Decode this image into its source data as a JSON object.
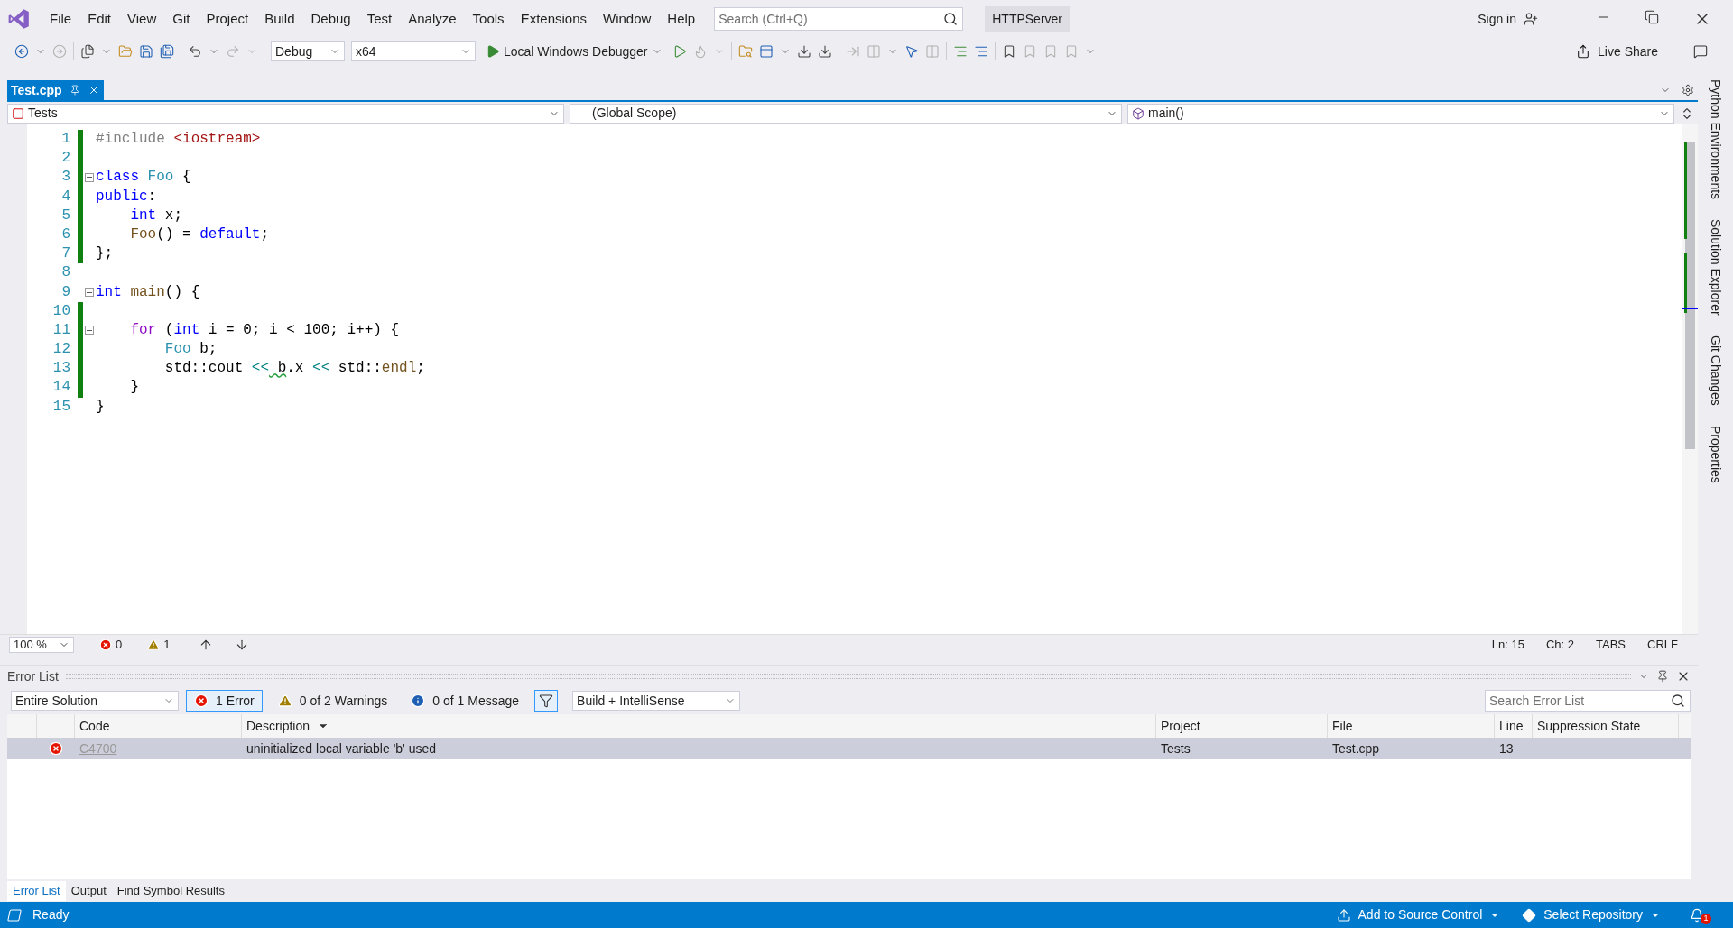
{
  "menu": [
    "File",
    "Edit",
    "View",
    "Git",
    "Project",
    "Build",
    "Debug",
    "Test",
    "Analyze",
    "Tools",
    "Extensions",
    "Window",
    "Help"
  ],
  "search": {
    "placeholder": "Search (Ctrl+Q)"
  },
  "solution_name": "HTTPServer",
  "sign_in": "Sign in",
  "toolbar": {
    "configuration": "Debug",
    "platform": "x64",
    "debugger": "Local Windows Debugger"
  },
  "live_share": "Live Share",
  "document_tabs": [
    {
      "label": "Test.cpp",
      "selected": true
    }
  ],
  "nav_bar": {
    "project": "Tests",
    "scope": "(Global Scope)",
    "member": "main()"
  },
  "editor": {
    "lines": [
      {
        "number": "1",
        "changed": true,
        "fold": false,
        "tokens": [
          {
            "kind": "pp",
            "text": "#include "
          },
          {
            "kind": "str",
            "text": "<iostream>"
          }
        ]
      },
      {
        "number": "2",
        "changed": true,
        "fold": false
      },
      {
        "number": "3",
        "changed": true,
        "fold": true,
        "tokens": [
          {
            "kind": "kw",
            "text": "class "
          },
          {
            "kind": "type",
            "text": "Foo"
          },
          {
            "kind": "plain",
            "text": " {"
          }
        ]
      },
      {
        "number": "4",
        "changed": true,
        "fold": false,
        "tokens": [
          {
            "kind": "kw",
            "text": "public"
          },
          {
            "kind": "plain",
            "text": ":"
          }
        ]
      },
      {
        "number": "5",
        "changed": true,
        "fold": false,
        "tokens": [
          {
            "kind": "kw",
            "text": "    int"
          },
          {
            "kind": "plain",
            "text": " x;"
          }
        ]
      },
      {
        "number": "6",
        "changed": true,
        "fold": false,
        "tokens": [
          {
            "kind": "fn",
            "text": "    Foo"
          },
          {
            "kind": "plain",
            "text": "() = "
          },
          {
            "kind": "kw",
            "text": "default"
          },
          {
            "kind": "plain",
            "text": ";"
          }
        ]
      },
      {
        "number": "7",
        "changed": true,
        "fold": false,
        "tokens": [
          {
            "kind": "plain",
            "text": "};"
          }
        ]
      },
      {
        "number": "8",
        "changed": false,
        "fold": false
      },
      {
        "number": "9",
        "changed": false,
        "fold": true,
        "tokens": [
          {
            "kind": "kw",
            "text": "int"
          },
          {
            "kind": "fn",
            "text": " main"
          },
          {
            "kind": "plain",
            "text": "() {"
          }
        ]
      },
      {
        "number": "10",
        "changed": true,
        "fold": false
      },
      {
        "number": "11",
        "changed": true,
        "fold": true,
        "tokens": [
          {
            "kind": "ctl",
            "text": "    for"
          },
          {
            "kind": "plain",
            "text": " ("
          },
          {
            "kind": "kw",
            "text": "int"
          },
          {
            "kind": "plain",
            "text": " i = 0; i < 100; i++) {"
          }
        ]
      },
      {
        "number": "12",
        "changed": true,
        "fold": false,
        "tokens": [
          {
            "kind": "type",
            "text": "        Foo"
          },
          {
            "kind": "plain",
            "text": " b;"
          }
        ]
      },
      {
        "number": "13",
        "changed": true,
        "fold": false,
        "tokens": [
          {
            "kind": "plain",
            "text": "        std::cout "
          },
          {
            "kind": "op",
            "text": "<<"
          },
          {
            "kind": "squiggle",
            "text": " b"
          },
          {
            "kind": "plain",
            "text": ".x "
          },
          {
            "kind": "op",
            "text": "<<"
          },
          {
            "kind": "plain",
            "text": " std::"
          },
          {
            "kind": "fn",
            "text": "endl"
          },
          {
            "kind": "plain",
            "text": ";"
          }
        ]
      },
      {
        "number": "14",
        "changed": true,
        "fold": false,
        "tokens": [
          {
            "kind": "plain",
            "text": "    }"
          }
        ]
      },
      {
        "number": "15",
        "changed": false,
        "fold": false,
        "tokens": [
          {
            "kind": "plain",
            "text": "}"
          }
        ]
      }
    ]
  },
  "editor_status": {
    "zoom": "100 %",
    "errors": "0",
    "warnings": "1",
    "line": "Ln: 15",
    "column": "Ch: 2",
    "indent": "TABS",
    "line_ending": "CRLF"
  },
  "side_tabs": [
    "Python Environments",
    "Solution Explorer",
    "Git Changes",
    "Properties"
  ],
  "error_list": {
    "title": "Error List",
    "scope": "Entire Solution",
    "filters": [
      {
        "kind": "error",
        "label": "1 Error",
        "selected": true
      },
      {
        "kind": "warning",
        "label": "0 of 2 Warnings",
        "selected": false
      },
      {
        "kind": "message",
        "label": "0 of 1 Message",
        "selected": false
      }
    ],
    "source": "Build + IntelliSense",
    "search_placeholder": "Search Error List",
    "columns": [
      "Code",
      "Description",
      "Project",
      "File",
      "Line",
      "Suppression State"
    ],
    "rows": [
      {
        "selected": true,
        "code": "C4700",
        "description": "uninitialized local variable 'b' used",
        "project": "Tests",
        "file": "Test.cpp",
        "line": "13"
      }
    ]
  },
  "bottom_tabs": [
    {
      "label": "Error List",
      "selected": true
    },
    {
      "label": "Output",
      "selected": false
    },
    {
      "label": "Find Symbol Results",
      "selected": false
    }
  ],
  "status_bar": {
    "state": "Ready",
    "source_control": "Add to Source Control",
    "repository": "Select Repository",
    "notifications": "1"
  }
}
